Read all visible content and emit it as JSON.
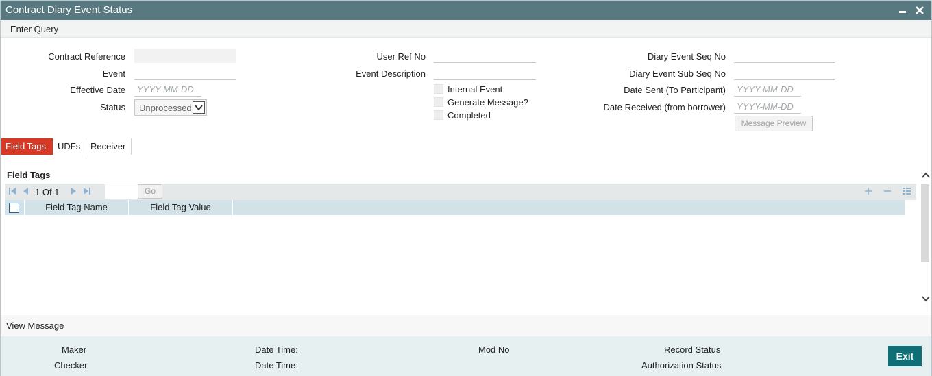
{
  "window": {
    "title": "Contract Diary Event Status",
    "minimize_icon": "minimize-icon",
    "close_icon": "close-icon"
  },
  "menu": {
    "enter_query": "Enter Query"
  },
  "form": {
    "contract_reference_label": "Contract Reference",
    "contract_reference_value": "",
    "event_label": "Event",
    "event_value": "",
    "effective_date_label": "Effective Date",
    "effective_date_placeholder": "YYYY-MM-DD",
    "status_label": "Status",
    "status_value": "Unprocessed",
    "user_ref_no_label": "User Ref No",
    "user_ref_no_value": "",
    "event_description_label": "Event Description",
    "event_description_value": "",
    "internal_event_label": "Internal Event",
    "generate_message_label": "Generate Message?",
    "completed_label": "Completed",
    "diary_event_seq_no_label": "Diary Event Seq No",
    "diary_event_seq_no_value": "",
    "diary_event_sub_seq_no_label": "Diary Event Sub Seq No",
    "diary_event_sub_seq_no_value": "",
    "date_sent_label": "Date Sent (To Participant)",
    "date_sent_placeholder": "YYYY-MM-DD",
    "date_received_label": "Date Received (from borrower)",
    "date_received_placeholder": "YYYY-MM-DD",
    "message_preview_label": "Message Preview"
  },
  "tabs": [
    {
      "label": "Field Tags",
      "active": true
    },
    {
      "label": "UDFs",
      "active": false
    },
    {
      "label": "Receiver",
      "active": false
    }
  ],
  "field_tags": {
    "heading": "Field Tags",
    "pager": {
      "current": "1",
      "of_label": "Of",
      "total": "1",
      "go_label": "Go"
    },
    "columns": [
      "Field Tag Name",
      "Field Tag Value"
    ],
    "rows": []
  },
  "view_message": {
    "label": "View Message"
  },
  "footer": {
    "maker_label": "Maker",
    "checker_label": "Checker",
    "date_time_label_1": "Date Time:",
    "date_time_label_2": "Date Time:",
    "mod_no_label": "Mod No",
    "record_status_label": "Record Status",
    "authorization_status_label": "Authorization Status",
    "exit_label": "Exit"
  },
  "colors": {
    "titlebar": "#57797f",
    "active_tab": "#d63a27",
    "exit_button": "#0f6f76",
    "grid_header": "#d3e2e6",
    "footer": "#e6f0f1"
  }
}
